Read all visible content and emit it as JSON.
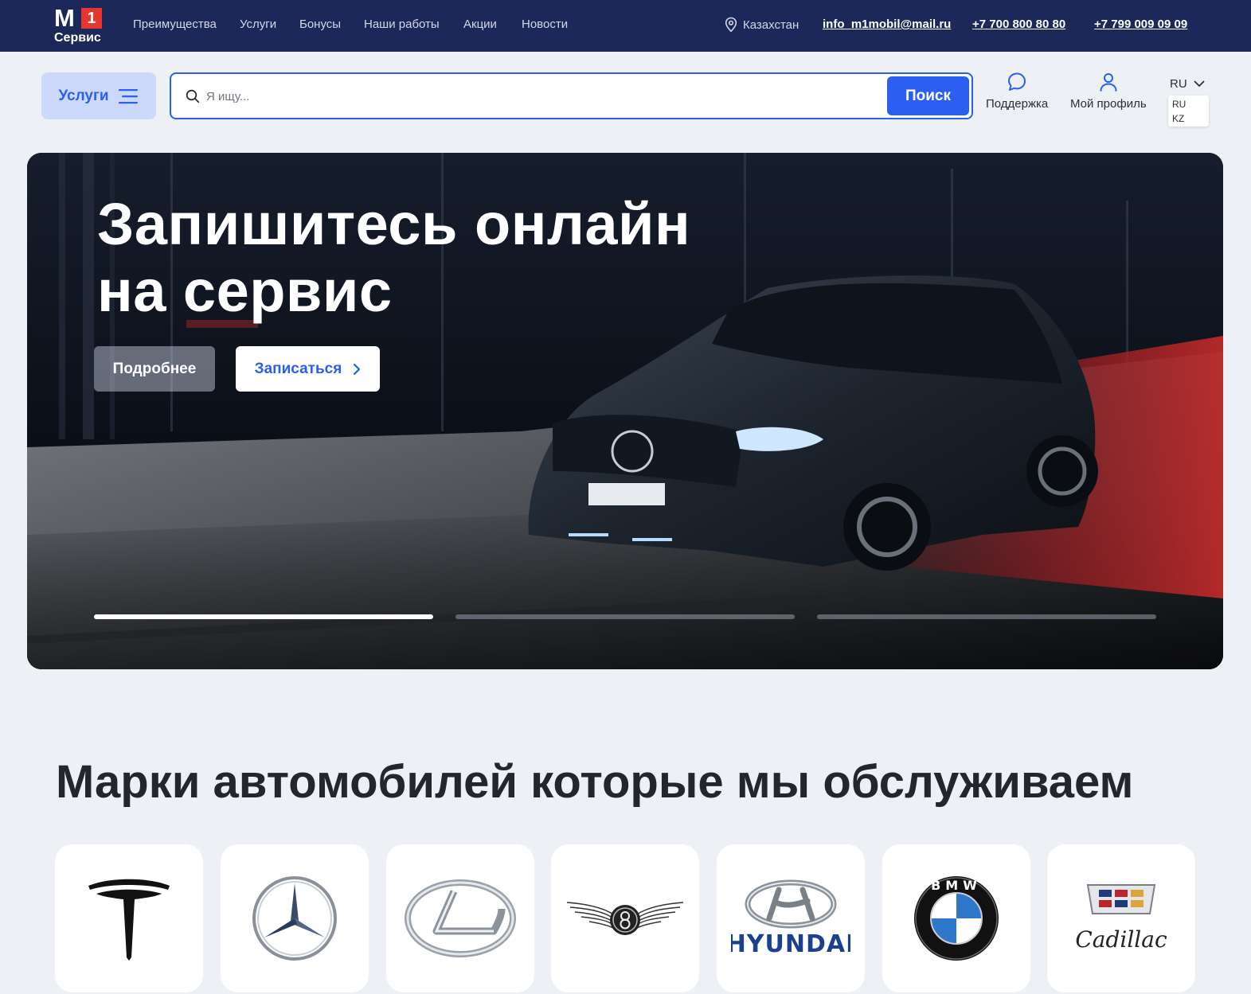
{
  "header": {
    "logo": {
      "big": "M",
      "num": "1",
      "sub": "Сервис"
    },
    "nav": [
      "Преимущества",
      "Услуги",
      "Бонусы",
      "Наши работы",
      "Акции",
      "Новости"
    ],
    "location": "Казахстан",
    "email": "info_m1mobil@mail.ru",
    "phones": [
      "+7 700 800 80 80",
      "+7 799 009 09 09"
    ]
  },
  "toolbar": {
    "services_label": "Услуги",
    "search_placeholder": "Я ищу...",
    "search_button": "Поиск",
    "support_label": "Поддержка",
    "profile_label": "Мой профиль",
    "lang_current": "RU",
    "lang_options": [
      "RU",
      "KZ"
    ]
  },
  "hero": {
    "title_line1": "Запишитесь онлайн",
    "title_line2": "на сервис",
    "more_button": "Подробнее",
    "book_button": "Записаться",
    "slides_total": 3,
    "active_slide": 1
  },
  "brands": {
    "title": "Марки автомобилей которые мы обслуживаем",
    "items": [
      {
        "name": "Tesla",
        "icon": "tesla-logo"
      },
      {
        "name": "Mercedes-Benz",
        "icon": "mercedes-logo"
      },
      {
        "name": "Lexus",
        "icon": "lexus-logo"
      },
      {
        "name": "Bentley",
        "icon": "bentley-logo"
      },
      {
        "name": "Hyundai",
        "wordmark": "HYUNDAI",
        "icon": "hyundai-logo"
      },
      {
        "name": "BMW",
        "wordmark": "BMW",
        "icon": "bmw-logo"
      },
      {
        "name": "Cadillac",
        "wordmark": "Cadillac",
        "icon": "cadillac-logo"
      }
    ]
  },
  "colors": {
    "header_bg": "#1b2859",
    "accent": "#2c5ef1",
    "services_btn_bg": "#cdd9fc",
    "page_bg": "#edf0f5",
    "logo_red": "#e7362f"
  }
}
